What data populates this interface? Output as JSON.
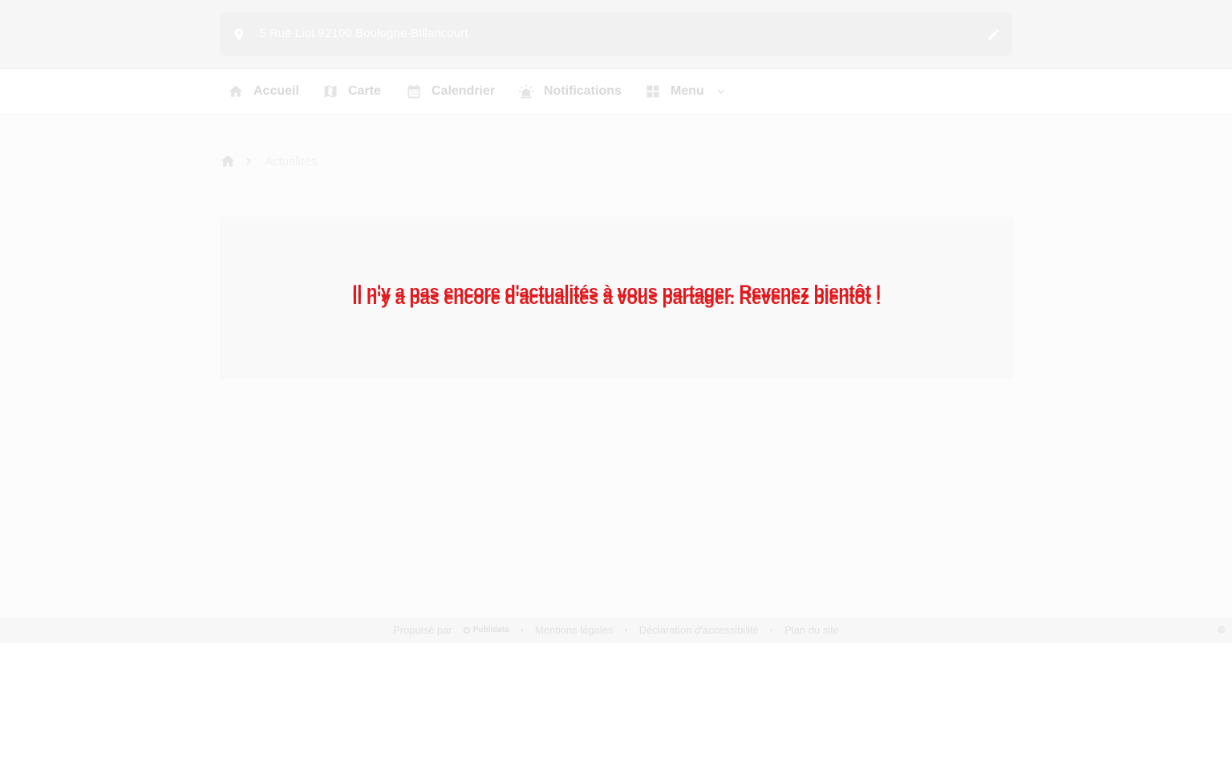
{
  "header": {
    "address": "5 Rue Liot 92100 Boulogne-Billancourt",
    "icons": {
      "location": "map-pin-icon",
      "edit": "pencil-icon"
    }
  },
  "nav": {
    "items": [
      {
        "label": "Accueil",
        "icon": "home-icon"
      },
      {
        "label": "Carte",
        "icon": "map-icon"
      },
      {
        "label": "Calendrier",
        "icon": "calendar-icon"
      },
      {
        "label": "Notifications",
        "icon": "alarm-light-icon"
      },
      {
        "label": "Menu",
        "icon": "grid-icon"
      }
    ]
  },
  "breadcrumb": {
    "home_icon": "home-icon",
    "current": "Actualités"
  },
  "main": {
    "empty_message": "Il n'y a pas encore d'actualités à vous partager. Revenez bientôt !"
  },
  "footer": {
    "powered_by": "Propulsé par",
    "brand": "Publidata",
    "links": [
      "Mentions légales",
      "Déclaration d'accessibilité",
      "Plan du site"
    ],
    "separator": "•"
  },
  "colors": {
    "message": "#e4141e",
    "nav_text": "#d9d9d9",
    "header_bg": "#f6f6f6"
  }
}
